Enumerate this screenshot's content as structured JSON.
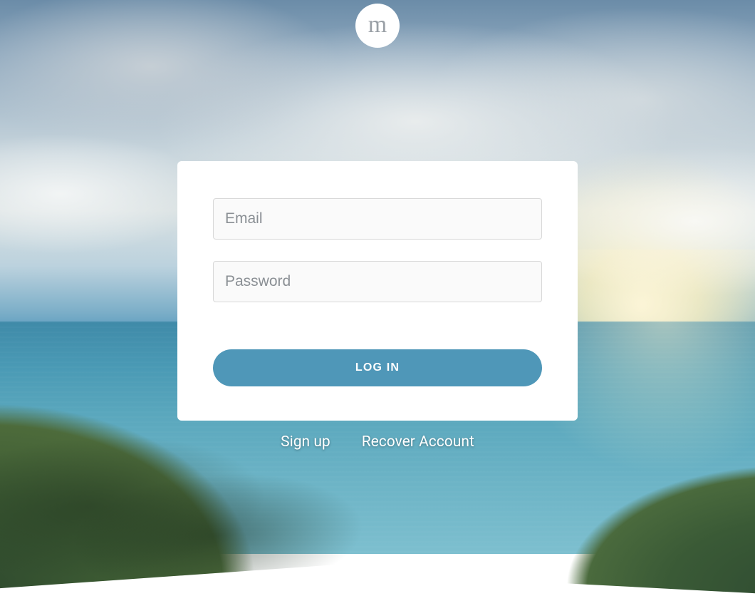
{
  "logo": {
    "letter": "m"
  },
  "form": {
    "email_placeholder": "Email",
    "password_placeholder": "Password",
    "submit_label": "LOG IN"
  },
  "links": {
    "signup_label": "Sign up",
    "recover_label": "Recover Account"
  },
  "colors": {
    "accent": "#4f97b8",
    "card_bg": "#ffffff"
  }
}
